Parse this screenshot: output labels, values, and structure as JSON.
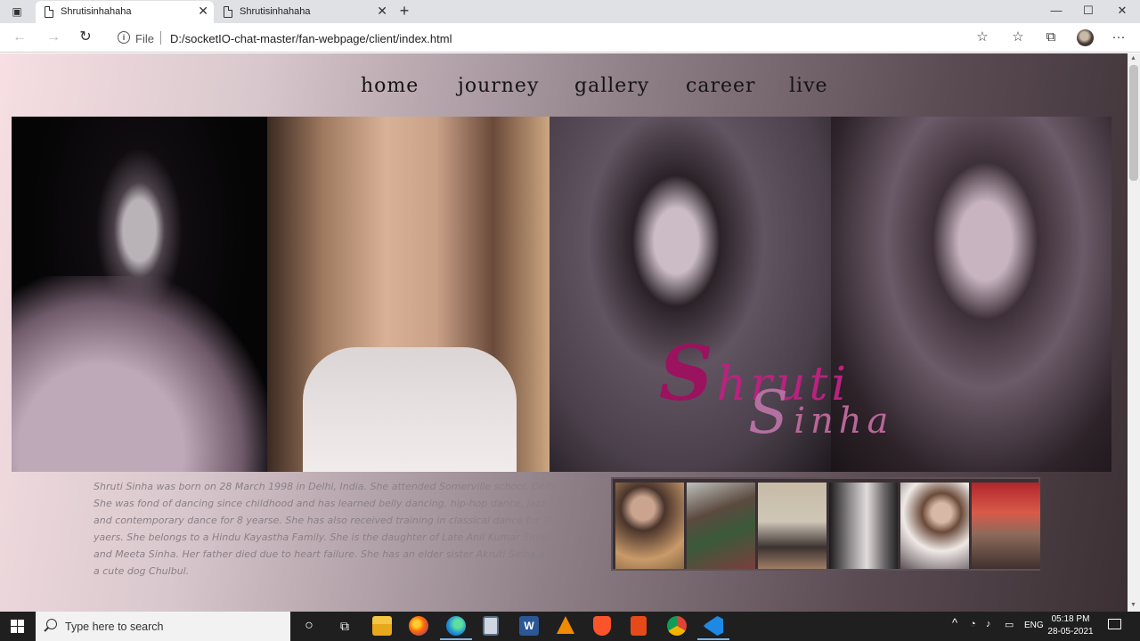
{
  "browser": {
    "tabs": [
      {
        "label": "Shrutisinhahaha",
        "active": true
      },
      {
        "label": "Shrutisinhahaha",
        "active": false
      }
    ],
    "close_glyph": "✕",
    "new_tab_glyph": "+",
    "window_controls": {
      "minimize": "—",
      "maximize": "☐",
      "close": "✕"
    },
    "nav": {
      "back": "←",
      "forward": "→",
      "reload": "↻"
    },
    "address": {
      "scheme_label": "File",
      "url": "D:/socketIO-chat-master/fan-webpage/client/index.html",
      "info_glyph": "i"
    },
    "toolbar_glyphs": {
      "favorite_add": "☆",
      "favorites": "☆",
      "collections": "⧉",
      "more": "···"
    }
  },
  "site": {
    "nav": [
      "home",
      "journey",
      "gallery",
      "career",
      "live"
    ],
    "brand": {
      "first_cap": "S",
      "first_rest": "hruti",
      "last_cap": "S",
      "last_rest": "inha"
    },
    "bio": "Shruti Sinha was born on 28 March 1998 in Delhi, India. She attended Somerville school, Delhi. She was fond of dancing since childhood and has learned belly dancing, hip-hop dance, jazz, and contemporary dance for 8 yearse. She has also received training in classical dance for 10 yaers. She belongs to a Hindu Kayastha Family. She is the daughter of Late Anil Kumar Sinha and Meeta Sinha. Her father died due to heart failure. She has an elder sister Akruti Sinha and a cute dog Chulbul.",
    "accent_color": "#b9227f"
  },
  "taskbar": {
    "search_placeholder": "Type here to search",
    "apps": [
      "cortana-icon",
      "task-view-icon",
      "file-explorer-icon",
      "firefox-icon",
      "edge-icon",
      "calculator-icon",
      "word-icon",
      "vlc-icon",
      "brave-icon",
      "office-icon",
      "chrome-icon",
      "vscode-icon"
    ],
    "tray": {
      "language": "ENG",
      "chevron": "^"
    },
    "clock": {
      "time": "05:18 PM",
      "date": "28-05-2021"
    }
  }
}
